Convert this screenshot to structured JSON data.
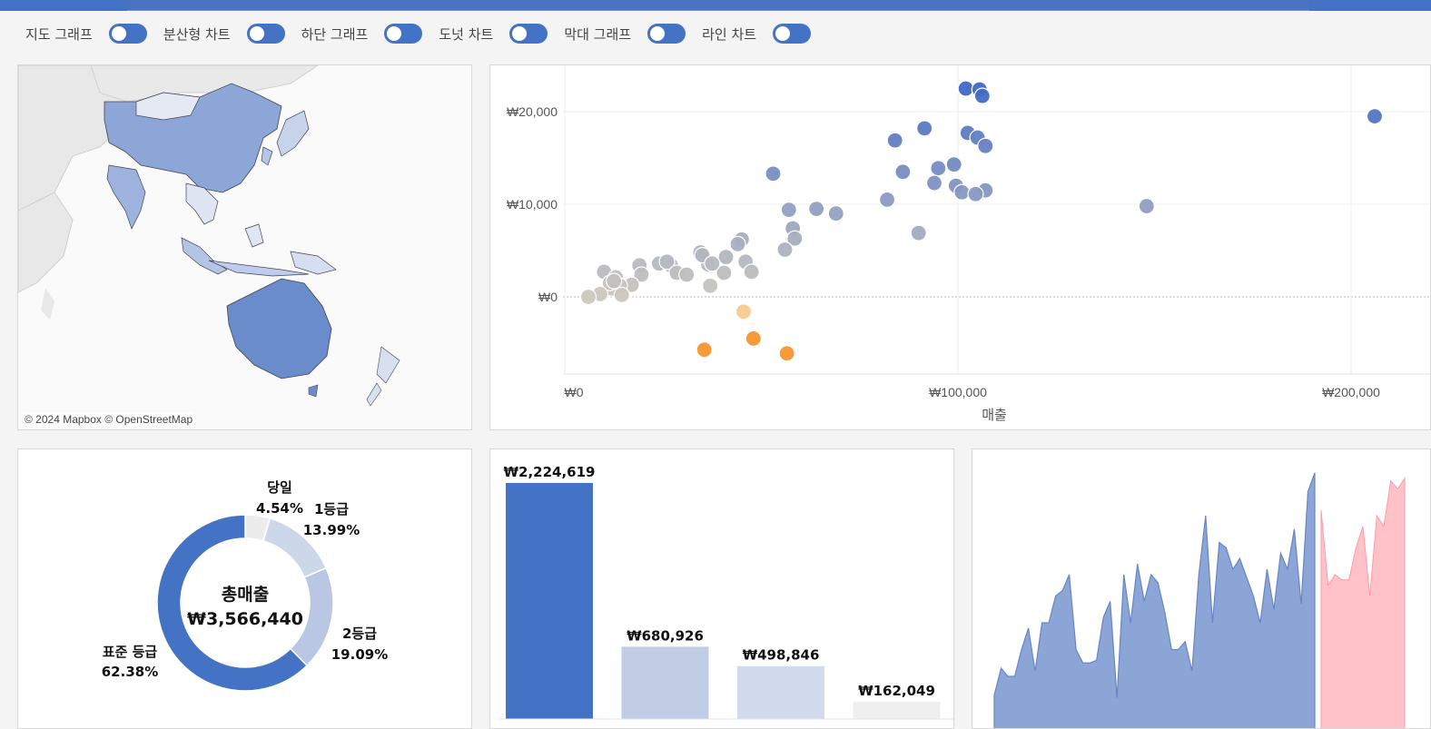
{
  "toolbar": {
    "toggles": [
      {
        "label": "지도 그래프",
        "on": true
      },
      {
        "label": "분산형 차트",
        "on": true
      },
      {
        "label": "하단 그래프",
        "on": true
      },
      {
        "label": "도넛 차트",
        "on": true
      },
      {
        "label": "막대 그래프",
        "on": true
      },
      {
        "label": "라인 차트",
        "on": true
      }
    ]
  },
  "map": {
    "attribution": "© 2024 Mapbox © OpenStreetMap",
    "colors": {
      "high": "#5b7fc8",
      "mid": "#8aa3d6",
      "low": "#d4dcee",
      "base": "#e6e6e6"
    }
  },
  "chart_data": [
    {
      "type": "scatter",
      "xlabel": "매출",
      "xlim": [
        0,
        220000
      ],
      "ylim": [
        -8000,
        24000
      ],
      "x_ticks": [
        "₩0",
        "₩100,000",
        "₩200,000"
      ],
      "y_ticks": [
        "₩0",
        "₩10,000",
        "₩20,000"
      ],
      "points": [
        [
          102000,
          22500
        ],
        [
          105500,
          22400
        ],
        [
          106200,
          21700
        ],
        [
          206000,
          19500
        ],
        [
          91500,
          18200
        ],
        [
          102500,
          17700
        ],
        [
          105000,
          17200
        ],
        [
          107000,
          16300
        ],
        [
          84000,
          16900
        ],
        [
          53000,
          13300
        ],
        [
          86000,
          13500
        ],
        [
          95000,
          13900
        ],
        [
          99000,
          14300
        ],
        [
          94000,
          12300
        ],
        [
          99500,
          12000
        ],
        [
          101000,
          11300
        ],
        [
          107000,
          11500
        ],
        [
          104500,
          11100
        ],
        [
          82000,
          10500
        ],
        [
          148000,
          9800
        ],
        [
          57000,
          9400
        ],
        [
          64000,
          9500
        ],
        [
          69000,
          9000
        ],
        [
          58000,
          7400
        ],
        [
          58500,
          6300
        ],
        [
          56000,
          5100
        ],
        [
          90000,
          6900
        ],
        [
          45000,
          6200
        ],
        [
          44000,
          5700
        ],
        [
          41000,
          4300
        ],
        [
          46000,
          3800
        ],
        [
          47500,
          2700
        ],
        [
          40500,
          2600
        ],
        [
          36500,
          3500
        ],
        [
          34500,
          4800
        ],
        [
          35000,
          4500
        ],
        [
          37500,
          3600
        ],
        [
          24000,
          3600
        ],
        [
          27000,
          3400
        ],
        [
          26000,
          3800
        ],
        [
          28500,
          2600
        ],
        [
          31000,
          2400
        ],
        [
          19000,
          3400
        ],
        [
          19500,
          2400
        ],
        [
          17000,
          1300
        ],
        [
          37000,
          1200
        ],
        [
          10000,
          2700
        ],
        [
          13000,
          2100
        ],
        [
          14000,
          1200
        ],
        [
          12000,
          900
        ],
        [
          11500,
          1500
        ],
        [
          12500,
          1700
        ],
        [
          9000,
          300
        ],
        [
          6000,
          0
        ],
        [
          14500,
          200
        ],
        [
          45500,
          -1600
        ],
        [
          35500,
          -5700
        ],
        [
          48000,
          -4500
        ],
        [
          56500,
          -6100
        ]
      ]
    },
    {
      "type": "pie",
      "center_title": "총매출",
      "center_value": "₩3,566,440",
      "slices": [
        {
          "name": "당일",
          "value": 4.54,
          "label": "당일",
          "pct": "4.54%",
          "color": "#ececec"
        },
        {
          "name": "1등급",
          "value": 13.99,
          "label": "1등급",
          "pct": "13.99%",
          "color": "#cdd7ea"
        },
        {
          "name": "2등급",
          "value": 19.09,
          "label": "2등급",
          "pct": "19.09%",
          "color": "#b9c7e4"
        },
        {
          "name": "표준 등급",
          "value": 62.38,
          "label": "표준 등급",
          "pct": "62.38%",
          "color": "#4472c4"
        }
      ]
    },
    {
      "type": "bar",
      "values": [
        2224619,
        680926,
        498846,
        162049
      ],
      "labels": [
        "₩2,224,619",
        "₩680,926",
        "₩498,846",
        "₩162,049"
      ],
      "colors": [
        "#4472c4",
        "#c0cbe4",
        "#d2dbeb",
        "#efefef"
      ],
      "ylim": [
        0,
        2224619
      ]
    },
    {
      "type": "area",
      "ylim": [
        0,
        100
      ],
      "actual": [
        13,
        23,
        20,
        20,
        30,
        38,
        22,
        40,
        40,
        50,
        52,
        58,
        30,
        25,
        25,
        26,
        42,
        48,
        12,
        58,
        40,
        62,
        48,
        58,
        55,
        44,
        30,
        30,
        33,
        22,
        58,
        80,
        40,
        70,
        68,
        60,
        64,
        57,
        50,
        40,
        60,
        45,
        66,
        60,
        75,
        47,
        89,
        96
      ],
      "forecast": [
        82,
        54,
        58,
        56,
        56,
        68,
        76,
        50,
        80,
        76,
        93,
        90,
        94
      ],
      "colors": {
        "actual": "#8ba5d6",
        "actual_line": "#6686c4",
        "forecast": "#ffc2c8",
        "forecast_line": "#ff9aa6"
      }
    }
  ]
}
